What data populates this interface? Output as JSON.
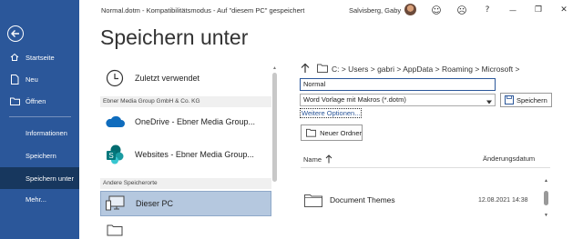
{
  "titlebar": {
    "title": "Normal.dotm  -  Kompatibilitätsmodus  -  Auf \"diesem PC\" gespeichert",
    "user": "Salvisberg, Gaby",
    "icons": [
      "smiley-icon",
      "sad-face-icon",
      "help-icon",
      "minimize-icon",
      "restore-icon",
      "close-icon"
    ],
    "glyphs": {
      "smiley": "☺",
      "sad": "☹",
      "help": "?",
      "minimize": "—",
      "restore": "❐",
      "close": "✕"
    }
  },
  "sidebar": {
    "background": "#2b579a",
    "items": [
      {
        "label": "Startseite",
        "icon": "home-icon"
      },
      {
        "label": "Neu",
        "icon": "new-document-icon"
      },
      {
        "label": "Öffnen",
        "icon": "open-folder-icon"
      },
      {
        "label": "Informationen"
      },
      {
        "label": "Speichern"
      },
      {
        "label": "Speichern unter",
        "active": true
      },
      {
        "label": "Mehr..."
      }
    ]
  },
  "page": {
    "title": "Speichern unter"
  },
  "locations": {
    "recent": "Zuletzt verwendet",
    "group_org": "Ebner Media Group GmbH & Co. KG",
    "onedrive": "OneDrive - Ebner Media Group...",
    "sites": "Websites - Ebner Media Group...",
    "group_other": "Andere Speicherorte",
    "this_pc": "Dieser PC"
  },
  "path": {
    "segments": "C: > Users > gabri > AppData > Roaming > Microsoft >"
  },
  "form": {
    "filename": "Normal",
    "filetype": "Word Vorlage mit Makros (*.dotm)",
    "more_options": "Weitere Optionen...",
    "save": "Speichern",
    "new_folder": "Neuer Ordner"
  },
  "files": {
    "col_name": "Name",
    "col_date": "Änderungsdatum",
    "rows": [
      {
        "name": "Document Themes",
        "date": "12.08.2021 14:38"
      }
    ]
  }
}
